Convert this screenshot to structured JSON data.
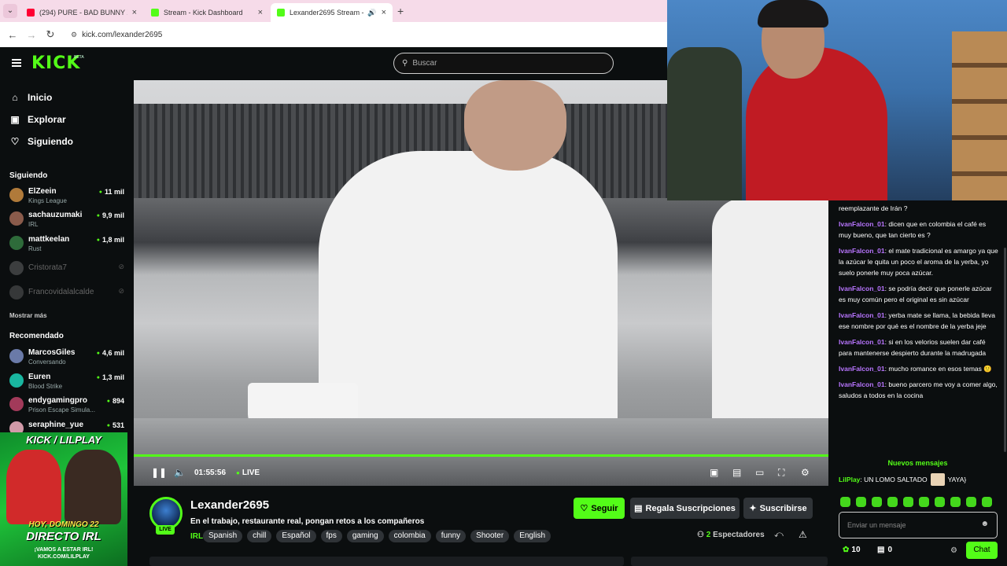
{
  "browser": {
    "tabs": [
      {
        "title": "(294) PURE - BAD BUNNY X FA...",
        "favicon_color": "#ff0033"
      },
      {
        "title": "Stream - Kick Dashboard",
        "favicon_color": "#53fc18"
      },
      {
        "title": "Lexander2695 Stream - Wa...",
        "favicon_color": "#53fc18"
      }
    ],
    "url": "kick.com/lexander2695"
  },
  "kick": {
    "logo": "KICK",
    "logo_badge": "BETA",
    "search_placeholder": "Buscar"
  },
  "sidebar": {
    "nav": [
      {
        "label": "Inicio",
        "icon": "home-icon"
      },
      {
        "label": "Explorar",
        "icon": "compass-icon"
      },
      {
        "label": "Siguiendo",
        "icon": "heart-icon"
      }
    ],
    "following_title": "Siguiendo",
    "following": [
      {
        "name": "ElZeein",
        "category": "Kings League",
        "viewers": "11 mil",
        "color": "#b07a3a"
      },
      {
        "name": "sachauzumaki",
        "category": "IRL",
        "viewers": "9,9 mil",
        "color": "#8a5b4b"
      },
      {
        "name": "mattkeelan",
        "category": "Rust",
        "viewers": "1,8 mil",
        "color": "#2e6b3a"
      },
      {
        "name": "Cristorata7",
        "category": "",
        "viewers": "",
        "color": "#888888"
      },
      {
        "name": "Francovidalalcalde",
        "category": "",
        "viewers": "",
        "color": "#777777"
      }
    ],
    "show_more": "Mostrar más",
    "recommended_title": "Recomendado",
    "recommended": [
      {
        "name": "MarcosGiles",
        "category": "Conversando",
        "viewers": "4,6 mil",
        "color": "#6a7aa8"
      },
      {
        "name": "Euren",
        "category": "Blood Strike",
        "viewers": "1,3 mil",
        "color": "#19b6a0"
      },
      {
        "name": "endygamingpro",
        "category": "Prison Escape Simula...",
        "viewers": "894",
        "color": "#a23a5a"
      },
      {
        "name": "seraphine_yue",
        "category": "",
        "viewers": "531",
        "color": "#d19aa8"
      }
    ]
  },
  "promo": {
    "title": "KICK / LILPLAY",
    "line1": "HOY, DOMINGO 22",
    "line2": "DIRECTO IRL",
    "line3": "¡VAMOS A ESTAR IRL!",
    "line4": "KICK.COM/LILPLAY"
  },
  "player": {
    "time": "01:55:56",
    "live_label": "LIVE",
    "progress": 1.0
  },
  "stream": {
    "name": "Lexander2695",
    "live_badge": "LIVE",
    "title": "En el trabajo, restaurante real, pongan retos a los compañeros",
    "category": "IRL",
    "tags": [
      "Spanish",
      "chill",
      "Español",
      "fps",
      "gaming",
      "colombia",
      "funny",
      "Shooter",
      "English"
    ],
    "follow_label": "Seguir",
    "gift_label": "Regala Suscripciones",
    "subscribe_label": "Suscribirse",
    "viewer_count": "2",
    "viewer_label": "Espectadores"
  },
  "chat": {
    "messages": [
      {
        "user": "",
        "text": "reemplazante de Irán ?"
      },
      {
        "user": "IvanFalcon_01",
        "text": "dicen que en colombia el café es muy bueno, que tan cierto es ?"
      },
      {
        "user": "IvanFalcon_01",
        "text": "el mate tradicional es amargo ya que la azúcar le quita un poco el aroma de la yerba, yo suelo ponerle muy poca azúcar."
      },
      {
        "user": "IvanFalcon_01",
        "text": "se podría decir que ponerle azúcar es muy común pero el original es sin azúcar"
      },
      {
        "user": "IvanFalcon_01",
        "text": "yerba mate se llama, la bebida lleva ese nombre por qué es el nombre de la yerba jeje"
      },
      {
        "user": "IvanFalcon_01",
        "text": "si en los velorios suelen dar café para mantenerse despierto durante la madrugada"
      },
      {
        "user": "IvanFalcon_01",
        "text": "mucho romance en esos temas 🙂"
      },
      {
        "user": "IvanFalcon_01",
        "text": "bueno parcero me voy a comer algo, saludos a todos en la cocina"
      }
    ],
    "new_messages": "Nuevos mensajes",
    "latest": {
      "user": "LilPlay",
      "text_a": "UN LOMO SALTADO",
      "text_b": "YAYA}"
    },
    "input_placeholder": "Enviar un mensaje",
    "points": "10",
    "gifts": "0",
    "send_label": "Chat",
    "emote_count": 10
  }
}
